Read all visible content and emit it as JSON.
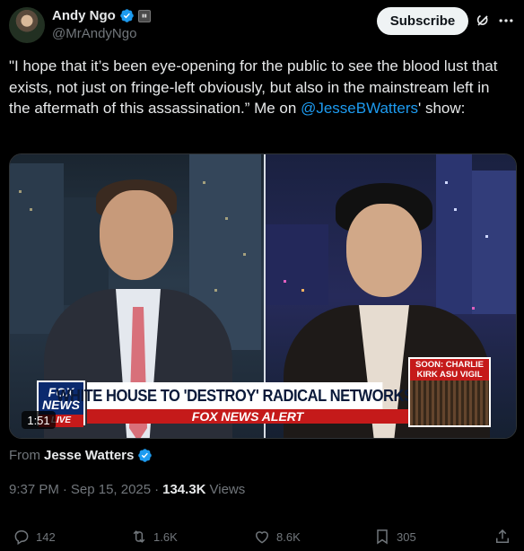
{
  "author": {
    "display_name": "Andy Ngo",
    "handle": "@MrAndyNgo"
  },
  "header": {
    "subscribe_label": "Subscribe"
  },
  "tweet": {
    "text_part1": "\"I hope that it’s been eye-opening for the public to see the blood lust that exists, not just on fringe-left obviously, but also in the mainstream left in the aftermath of this assassination.” Me on ",
    "mention": "@JesseBWatters",
    "text_part2": "' show:"
  },
  "media": {
    "duration": "1:51",
    "banner_headline": "WHITE HOUSE TO 'DESTROY' RADICAL NETWORKS",
    "banner_alert": "FOX NEWS ALERT",
    "logo_text_1": "FOX",
    "logo_text_2": "NEWS",
    "logo_live": "LIVE",
    "soon_label": "SOON: CHARLIE KIRK ASU VIGIL"
  },
  "source": {
    "prefix": "From",
    "name": "Jesse Watters"
  },
  "meta": {
    "time": "9:37 PM",
    "separator1": "·",
    "date": "Sep 15, 2025",
    "separator2": "·",
    "views_count": "134.3K",
    "views_label": "Views"
  },
  "actions": {
    "replies": "142",
    "reposts": "1.6K",
    "likes": "8.6K",
    "bookmarks": "305"
  },
  "colors": {
    "accent": "#1d9bf0",
    "background": "#000000",
    "text": "#e7e9ea",
    "muted": "#71767b"
  }
}
